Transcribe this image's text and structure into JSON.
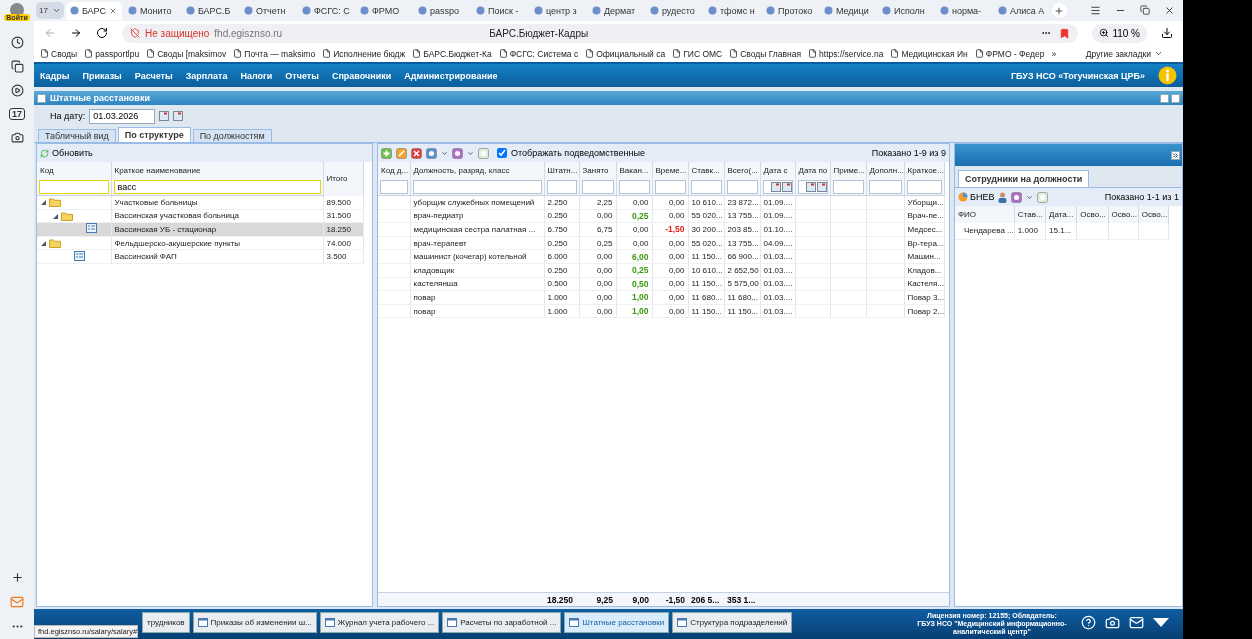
{
  "browser": {
    "profile_label": "Войти",
    "sidebar_calendar": "17",
    "tab_count": "17",
    "tabs": [
      {
        "label": "БАРС",
        "selected": true
      },
      {
        "label": "Монито",
        "selected": false
      },
      {
        "label": "БАРС.Б",
        "selected": false
      },
      {
        "label": "Отчетн",
        "selected": false
      },
      {
        "label": "ФСГС: С",
        "selected": false
      },
      {
        "label": "ФРМО",
        "selected": false
      },
      {
        "label": "passpo",
        "selected": false
      },
      {
        "label": "Поиск -",
        "selected": false
      },
      {
        "label": "центр з",
        "selected": false
      },
      {
        "label": "Дермат",
        "selected": false
      },
      {
        "label": "рудесто",
        "selected": false
      },
      {
        "label": "тфомс н",
        "selected": false
      },
      {
        "label": "Протоко",
        "selected": false
      },
      {
        "label": "Медици",
        "selected": false
      },
      {
        "label": "Исполн",
        "selected": false
      },
      {
        "label": "норма-",
        "selected": false
      },
      {
        "label": "Алиса А",
        "selected": false
      }
    ],
    "security": "Не защищено",
    "url": "fhd.egisznso.ru",
    "page_title": "БАРС.Бюджет-Кадры",
    "zoom": "110 %",
    "bookmarks": [
      "Своды",
      "passportlpu",
      "Своды [maksimov",
      "Почта — maksimo",
      "Исполнение бюдж",
      "БАРС.Бюджет-Ка",
      "ФСГС: Система с",
      "Официальный са",
      "ГИС ОМС",
      "Своды Главная",
      "https://service.na",
      "Медицинская Ин",
      "ФРМО - Федер"
    ],
    "bookmarks_more": "»",
    "other_bookmarks": "Другие закладки",
    "status_url": "fhd.egisznso.ru/salary/salary#"
  },
  "app": {
    "menu": [
      "Кадры",
      "Приказы",
      "Расчеты",
      "Зарплата",
      "Налоги",
      "Отчеты",
      "Справочники",
      "Администрирование"
    ],
    "organization": "ГБУЗ НСО «Тогучинская ЦРБ»",
    "window_title": "Штатные расстановки",
    "date_label": "На дату:",
    "date_value": "01.03.2026",
    "view_tabs": [
      {
        "label": "Табличный вид",
        "selected": false
      },
      {
        "label": "По структуре",
        "selected": true
      },
      {
        "label": "По должностям",
        "selected": false
      }
    ],
    "tree": {
      "refresh": "Обновить",
      "columns": [
        "Код",
        "Краткое наименование",
        "Итого"
      ],
      "name_filter": "васс",
      "nodes": [
        {
          "kind": "folder",
          "name": "Участковые больницы",
          "total": "89.500",
          "expanded": true,
          "selected": false,
          "children": [
            {
              "kind": "folder",
              "name": "Вассинская участковая больница",
              "total": "31.500",
              "expanded": true,
              "selected": false,
              "children": [
                {
                  "kind": "unit",
                  "name": "Вассинская УБ - стационар",
                  "total": "18.250",
                  "selected": true
                }
              ]
            }
          ]
        },
        {
          "kind": "folder",
          "name": "Фельдшерско-акушерские пункты",
          "total": "74.000",
          "expanded": true,
          "selected": false,
          "children": [
            {
              "kind": "unit",
              "name": "Вассинский ФАП",
              "total": "3.500",
              "selected": false
            }
          ]
        }
      ]
    },
    "grid": {
      "show_subordinate": {
        "label": "Отображать подведомственные",
        "checked": true
      },
      "paging": "Показано 1-9 из 9",
      "columns": [
        "Код д...",
        "Должность, разряд, класс",
        "Штатн...",
        "Занято",
        "Вакан...",
        "Време...",
        "Ставк...",
        "Всего(...",
        "Дата с",
        "Дата по",
        "Приме...",
        "Дополн...",
        "Краткое..."
      ],
      "rows": [
        {
          "position": "уборщик служебных помещений",
          "staff": "2.250",
          "occupied": "2,25",
          "vacant": "0,00",
          "temporary": "0,00",
          "rate": "10 610...",
          "total": "23 872...",
          "date_from": "01.09....",
          "short_name": "Уборщи..."
        },
        {
          "position": "врач-педиатр",
          "staff": "0.250",
          "occupied": "0,00",
          "vacant": {
            "text": "0,25",
            "color": "#3a9a0c"
          },
          "temporary": "0,00",
          "rate": "55 020...",
          "total": "13 755...",
          "date_from": "01.09....",
          "short_name": "Врач-пе..."
        },
        {
          "position": "медицинская сестра палатная ...",
          "staff": "6.750",
          "occupied": "6,75",
          "vacant": "0,00",
          "temporary": {
            "text": "-1,50",
            "color": "#e0201c"
          },
          "rate": "30 200...",
          "total": "203 85...",
          "date_from": "01.10....",
          "short_name": "Медсес..."
        },
        {
          "position": "врач-терапевт",
          "staff": "0.250",
          "occupied": "0,25",
          "vacant": "0,00",
          "temporary": "0,00",
          "rate": "55 020...",
          "total": "13 755...",
          "date_from": "04.09....",
          "short_name": "Вр-тера..."
        },
        {
          "position": "машинист (кочегар) котельной",
          "staff": "6.000",
          "occupied": "0,00",
          "vacant": {
            "text": "6,00",
            "color": "#3a9a0c"
          },
          "temporary": "0,00",
          "rate": "11 150...",
          "total": "66 900...",
          "date_from": "01.03....",
          "short_name": "Машин..."
        },
        {
          "position": "кладовщик",
          "staff": "0.250",
          "occupied": "0,00",
          "vacant": {
            "text": "0,25",
            "color": "#3a9a0c"
          },
          "temporary": "0,00",
          "rate": "10 610...",
          "total": "2 652,50",
          "date_from": "01.03....",
          "short_name": "Кладов..."
        },
        {
          "position": "кастелянша",
          "staff": "0.500",
          "occupied": "0,00",
          "vacant": {
            "text": "0,50",
            "color": "#3a9a0c"
          },
          "temporary": "0,00",
          "rate": "11 150...",
          "total": "5 575,00",
          "date_from": "01.03....",
          "short_name": "Кастеля..."
        },
        {
          "position": "повар",
          "staff": "1.000",
          "occupied": "0,00",
          "vacant": {
            "text": "1,00",
            "color": "#3a9a0c"
          },
          "temporary": "0,00",
          "rate": "11 680...",
          "total": "11 680...",
          "date_from": "01.03....",
          "short_name": "Повар 3..."
        },
        {
          "position": "повар",
          "staff": "1.000",
          "occupied": "0,00",
          "vacant": {
            "text": "1,00",
            "color": "#3a9a0c"
          },
          "temporary": "0,00",
          "rate": "11 150...",
          "total": "11 150...",
          "date_from": "01.03....",
          "short_name": "Повар 2..."
        }
      ],
      "totals": {
        "staff": "18.250",
        "occupied": "9,25",
        "vacant": "9,00",
        "temporary": "-1,50",
        "rate": "206 5...",
        "total": "353 1..."
      }
    },
    "employees": {
      "tab": "Сотрудники на должности",
      "filter_label": "БНЕВ",
      "paging": "Показано 1-1 из 1",
      "columns": [
        "ФИО",
        "Став...",
        "Дата...",
        "Осво...",
        "Осво...",
        "Осво..."
      ],
      "rows": [
        {
          "cells": [
            "Чендарева ...",
            "1.000",
            "15.1..."
          ]
        }
      ]
    }
  },
  "taskbar": {
    "items": [
      {
        "label": "трудников",
        "selected": false
      },
      {
        "label": "Приказы об изменении ш...",
        "selected": false
      },
      {
        "label": "Журнал учета рабочего ...",
        "selected": false
      },
      {
        "label": "Расчеты по заработной ...",
        "selected": false
      },
      {
        "label": "Штатные расстановки",
        "selected": true
      },
      {
        "label": "Структура подразделений",
        "selected": false
      }
    ],
    "license": "Лицензия номер: 12155; Обладатель:",
    "owner": "ГБУЗ НСО \"Медицинский информационно-аналитический центр\""
  }
}
